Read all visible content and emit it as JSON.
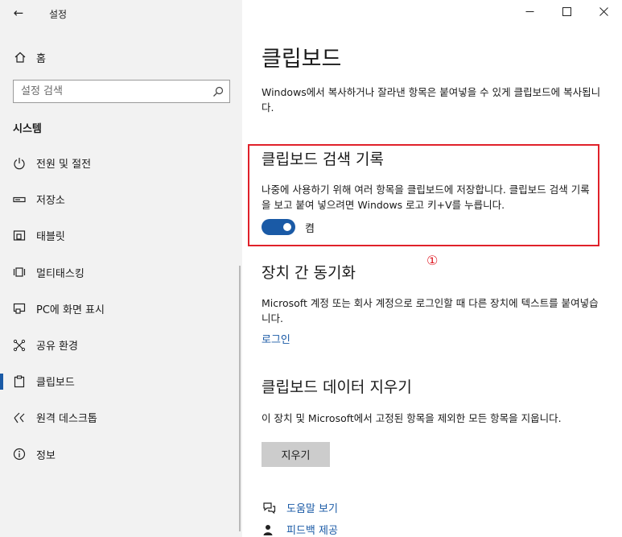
{
  "window": {
    "title": "설정",
    "controls": [
      "minimize",
      "maximize",
      "close"
    ]
  },
  "sidebar": {
    "home_label": "홈",
    "search": {
      "placeholder": "설정 검색",
      "value": ""
    },
    "section_title": "시스템",
    "items": [
      {
        "label": "전원 및 절전",
        "icon": "power-icon"
      },
      {
        "label": "저장소",
        "icon": "storage-icon"
      },
      {
        "label": "태블릿",
        "icon": "tablet-icon"
      },
      {
        "label": "멀티태스킹",
        "icon": "multitasking-icon"
      },
      {
        "label": "PC에 화면 표시",
        "icon": "project-icon"
      },
      {
        "label": "공유 환경",
        "icon": "shared-experience-icon"
      },
      {
        "label": "클립보드",
        "icon": "clipboard-icon",
        "active": true
      },
      {
        "label": "원격 데스크톱",
        "icon": "remote-desktop-icon"
      },
      {
        "label": "정보",
        "icon": "info-icon"
      }
    ]
  },
  "main": {
    "title": "클립보드",
    "intro": "Windows에서 복사하거나 잘라낸 항목은 붙여넣을 수 있게 클립보드에 복사됩니다.",
    "history": {
      "heading": "클립보드 검색 기록",
      "description": "나중에 사용하기 위해 여러 항목을 클립보드에 저장합니다. 클립보드 검색 기록을 보고 붙여 넣으려면 Windows 로고 키+V를 누릅니다.",
      "toggle_state": "켬",
      "toggle_on": true
    },
    "annotation_marker": "①",
    "sync": {
      "heading": "장치 간 동기화",
      "description": "Microsoft 계정 또는 회사 계정으로 로그인할 때 다른 장치에 텍스트를 붙여넣습니다.",
      "link": "로그인"
    },
    "clear": {
      "heading": "클립보드 데이터 지우기",
      "description": "이 장치 및 Microsoft에서 고정된 항목을 제외한 모든 항목을 지웁니다.",
      "button": "지우기"
    },
    "help_links": [
      {
        "label": "도움말 보기",
        "icon": "help-icon"
      },
      {
        "label": "피드백 제공",
        "icon": "feedback-icon"
      }
    ]
  },
  "colors": {
    "accent": "#1a5aa6",
    "highlight": "#e0212a",
    "sidebar_bg": "#f2f2f2",
    "button_bg": "#cccccc"
  }
}
